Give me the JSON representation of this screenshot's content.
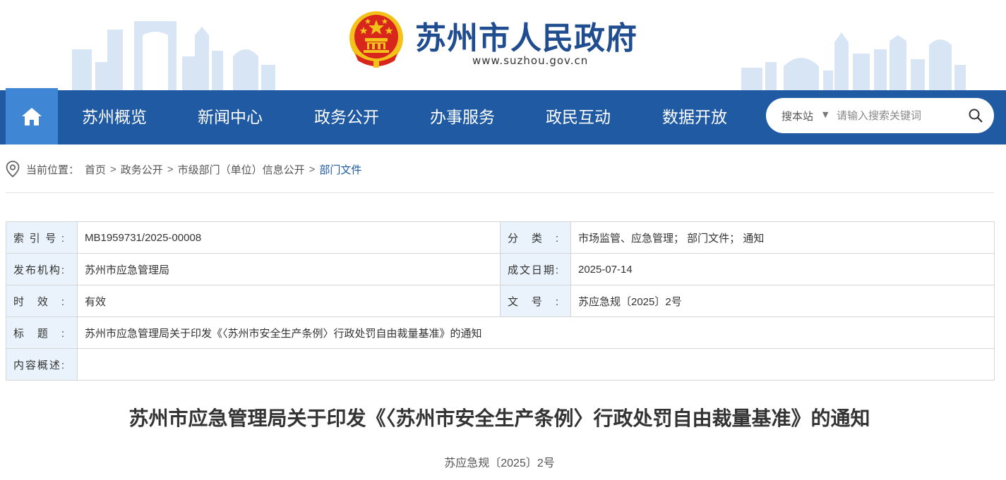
{
  "header": {
    "site_title": "苏州市人民政府",
    "site_url": "www.suzhou.gov.cn",
    "emblem": "national-emblem"
  },
  "nav": {
    "home_icon": "home-icon",
    "items": [
      {
        "label": "苏州概览"
      },
      {
        "label": "新闻中心"
      },
      {
        "label": "政务公开"
      },
      {
        "label": "办事服务"
      },
      {
        "label": "政民互动"
      },
      {
        "label": "数据开放"
      }
    ]
  },
  "search": {
    "scope_label": "搜本站",
    "caret": "▼",
    "placeholder": "请输入搜索关键词",
    "icon": "search-icon"
  },
  "breadcrumb": {
    "prefix": "当前位置：",
    "items": [
      {
        "label": "首页"
      },
      {
        "label": "政务公开"
      },
      {
        "label": "市级部门（单位）信息公开"
      },
      {
        "label": "部门文件"
      }
    ],
    "separator": ">"
  },
  "info": {
    "index_label": "索引号:",
    "index_value": "MB1959731/2025-00008",
    "category_label": "分类:",
    "category_value": "市场监管、应急管理； 部门文件； 通知",
    "publisher_label": "发布机构:",
    "publisher_value": "苏州市应急管理局",
    "date_label": "成文日期:",
    "date_value": "2025-07-14",
    "validity_label": "时效:",
    "validity_value": "有效",
    "docno_label": "文号:",
    "docno_value": "苏应急规〔2025〕2号",
    "title_label": "标题:",
    "title_value": "苏州市应急管理局关于印发《〈苏州市安全生产条例〉行政处罚自由裁量基准》的通知",
    "summary_label": "内容概述:",
    "summary_value": ""
  },
  "article": {
    "title": "苏州市应急管理局关于印发《〈苏州市安全生产条例〉行政处罚自由裁量基准》的通知",
    "doc_number": "苏应急规〔2025〕2号"
  },
  "colors": {
    "nav_bg": "#1f5aa3",
    "nav_home_bg": "#3f86d4",
    "title_blue": "#1f4d8f",
    "label_bg": "#eaf3fc",
    "emblem_red": "#d8261c",
    "emblem_gold": "#f3c21a"
  }
}
